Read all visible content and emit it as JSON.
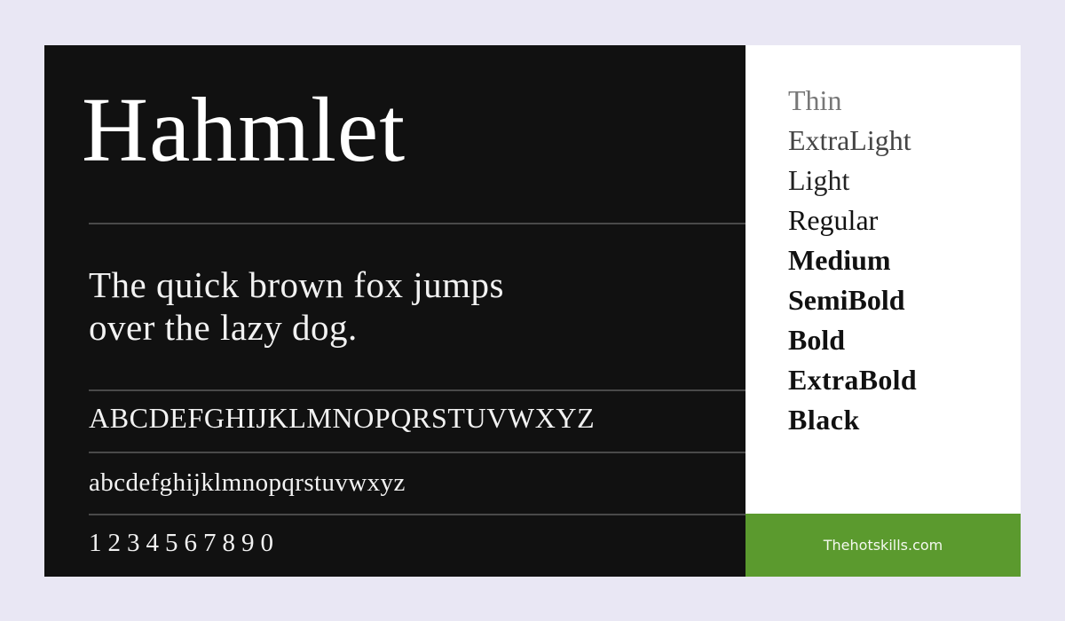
{
  "specimen": {
    "font_name": "Hahmlet",
    "pangram_line1": "The quick brown fox jumps",
    "pangram_line2": "over the lazy dog.",
    "uppercase": "ABCDEFGHIJKLMNOPQRSTUVWXYZ",
    "lowercase": "abcdefghijklmnopqrstuvwxyz",
    "digits": "1234567890"
  },
  "weights": [
    "Thin",
    "ExtraLight",
    "Light",
    "Regular",
    "Medium",
    "SemiBold",
    "Bold",
    "ExtraBold",
    "Black"
  ],
  "footer": {
    "site": "Thehotskills.com"
  },
  "colors": {
    "background": "#e9e7f4",
    "dark_panel": "#111111",
    "light_panel": "#ffffff",
    "accent": "#5b9a2e"
  }
}
